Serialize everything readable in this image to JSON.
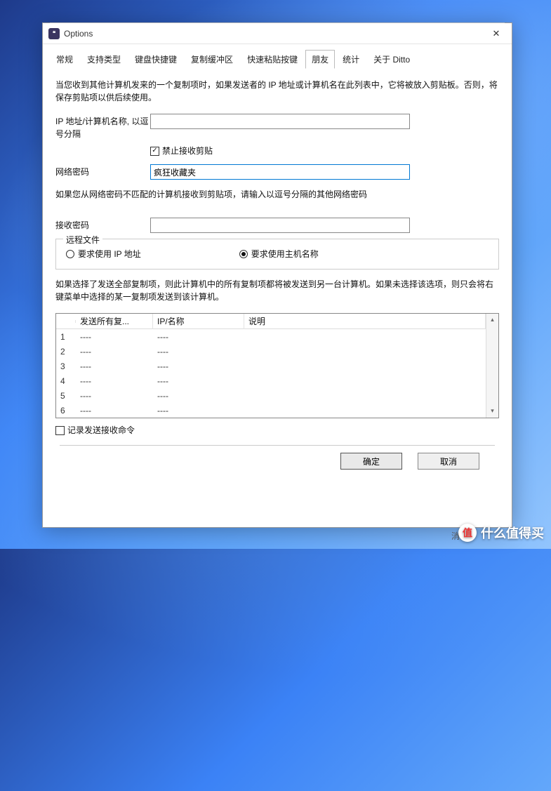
{
  "window": {
    "title": "Options",
    "icon_glyph": "❝"
  },
  "tabs": {
    "items": [
      "常规",
      "支持类型",
      "键盘快捷键",
      "复制缓冲区",
      "快速粘贴按键",
      "朋友",
      "统计",
      "关于 Ditto"
    ],
    "active_index": 5
  },
  "content": {
    "intro": "当您收到其他计算机发来的一个复制项时，如果发送者的 IP 地址或计算机名在此列表中，它将被放入剪贴板。否则，将保存剪贴项以供后续使用。",
    "ip_label": "IP 地址/计算机名称, 以逗号分隔",
    "ip_value": "",
    "deny_recv_checkbox": {
      "checked": true,
      "label": "禁止接收剪贴"
    },
    "net_pass_label": "网络密码",
    "net_pass_value": "疯狂收藏夹",
    "net_pass_note": "如果您从网络密码不匹配的计算机接收到剪贴项，请输入以逗号分隔的其他网络密码",
    "recv_pass_label": "接收密码",
    "recv_pass_value": "",
    "remote_file": {
      "legend": "远程文件",
      "option_ip": "要求使用 IP 地址",
      "option_host": "要求使用主机名称",
      "selected": "host"
    },
    "send_note": "如果选择了发送全部复制项，则此计算机中的所有复制项都将被发送到另一台计算机。如果未选择该选项，则只会将右键菜单中选择的某一复制项发送到该计算机。",
    "table": {
      "headers": [
        "",
        "发送所有复...",
        "IP/名称",
        "说明"
      ],
      "rows": [
        {
          "n": "1",
          "send": "----",
          "ip": "----",
          "desc": ""
        },
        {
          "n": "2",
          "send": "----",
          "ip": "----",
          "desc": ""
        },
        {
          "n": "3",
          "send": "----",
          "ip": "----",
          "desc": ""
        },
        {
          "n": "4",
          "send": "----",
          "ip": "----",
          "desc": ""
        },
        {
          "n": "5",
          "send": "----",
          "ip": "----",
          "desc": ""
        },
        {
          "n": "6",
          "send": "----",
          "ip": "----",
          "desc": ""
        }
      ]
    },
    "log_checkbox": {
      "checked": false,
      "label": "记录发送接收命令"
    }
  },
  "footer": {
    "ok": "确定",
    "cancel": "取消"
  },
  "watermark": {
    "badge": "值",
    "text": "什么值得买"
  },
  "shadow_text": "消"
}
